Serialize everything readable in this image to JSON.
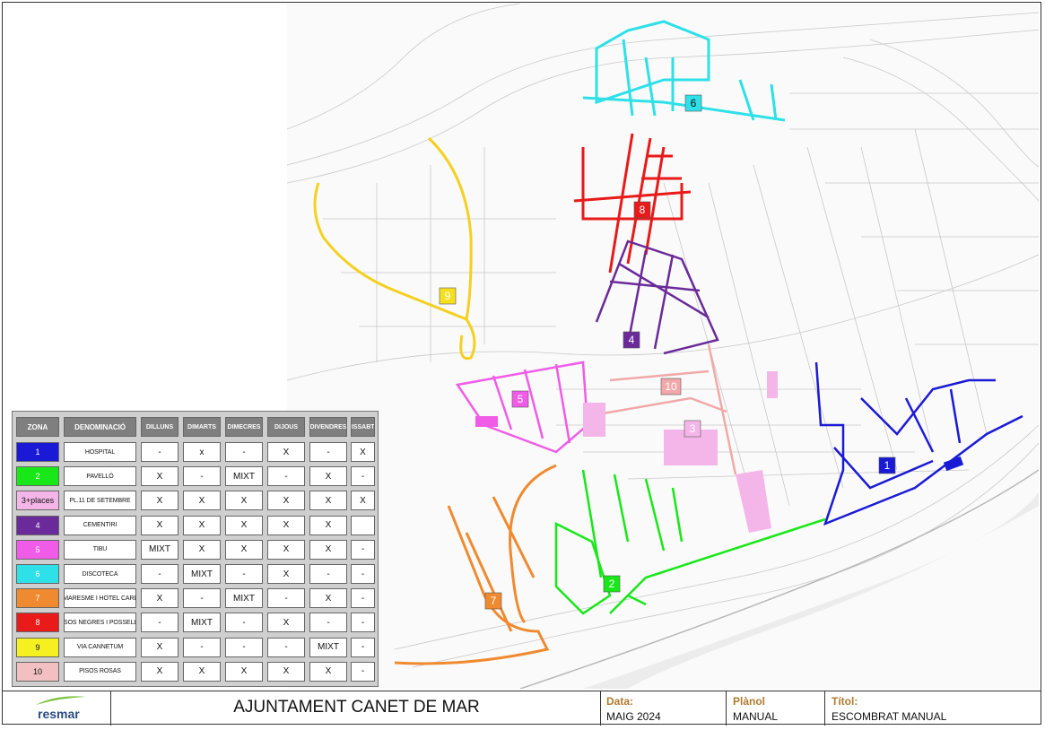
{
  "legend": {
    "headers": {
      "zona": "ZONA",
      "denominacio": "DENOMINACIÓ",
      "days": [
        "DILLUNS",
        "DIMARTS",
        "DIMECRES",
        "DIJOUS",
        "DIVENDRES",
        "DISSABTE"
      ]
    },
    "rows": [
      {
        "zona": "1",
        "color": "#1a1ad6",
        "text_color": "#ffffff",
        "name": "HOSPITAL",
        "days": [
          "-",
          "x",
          "-",
          "X",
          "-",
          "X"
        ]
      },
      {
        "zona": "2",
        "color": "#18e818",
        "text_color": "#ffffff",
        "name": "PAVELLÓ",
        "days": [
          "X",
          "-",
          "MIXT",
          "-",
          "X",
          "-"
        ]
      },
      {
        "zona": "3+places",
        "color": "#f4b6e8",
        "text_color": "#111111",
        "name": "PL.11 DE SETEMBRE",
        "days": [
          "X",
          "X",
          "X",
          "X",
          "X",
          "X"
        ]
      },
      {
        "zona": "4",
        "color": "#6a2a9a",
        "text_color": "#ffffff",
        "name": "CEMENTIRI",
        "days": [
          "X",
          "X",
          "X",
          "X",
          "X",
          ""
        ]
      },
      {
        "zona": "5",
        "color": "#f05ce8",
        "text_color": "#ffffff",
        "name": "TIBU",
        "days": [
          "MIXT",
          "X",
          "X",
          "X",
          "X",
          "-"
        ]
      },
      {
        "zona": "6",
        "color": "#2ee0e8",
        "text_color": "#ffffff",
        "name": "DISCOTECA",
        "days": [
          "-",
          "MIXT",
          "-",
          "X",
          "-",
          "-"
        ]
      },
      {
        "zona": "7",
        "color": "#f08a30",
        "text_color": "#ffffff",
        "name": "AV MARESME I HOTEL CARLOS",
        "days": [
          "X",
          "-",
          "MIXT",
          "-",
          "X",
          "-"
        ]
      },
      {
        "zona": "8",
        "color": "#e81a1a",
        "text_color": "#ffffff",
        "name": "PISOS NEGRES I POSSELLÓ",
        "days": [
          "-",
          "MIXT",
          "-",
          "X",
          "-",
          "-"
        ]
      },
      {
        "zona": "9",
        "color": "#f5f020",
        "text_color": "#111111",
        "name": "VIA CANNETUM",
        "days": [
          "X",
          "-",
          "-",
          "-",
          "MIXT",
          "-"
        ]
      },
      {
        "zona": "10",
        "color": "#f2c0c0",
        "text_color": "#111111",
        "name": "PISOS ROSAS",
        "days": [
          "X",
          "X",
          "X",
          "X",
          "X",
          "-"
        ]
      }
    ]
  },
  "map_zones": [
    {
      "label": "1",
      "color": "#1a1ad6",
      "text_color": "#ffffff"
    },
    {
      "label": "2",
      "color": "#18e818",
      "text_color": "#ffffff"
    },
    {
      "label": "3",
      "color": "#f4b6e8",
      "text_color": "#ffffff"
    },
    {
      "label": "4",
      "color": "#6a2a9a",
      "text_color": "#ffffff"
    },
    {
      "label": "5",
      "color": "#f05ce8",
      "text_color": "#ffffff"
    },
    {
      "label": "6",
      "color": "#2ee0e8",
      "text_color": "#111111"
    },
    {
      "label": "7",
      "color": "#f08a30",
      "text_color": "#ffffff"
    },
    {
      "label": "8",
      "color": "#e81a1a",
      "text_color": "#ffffff"
    },
    {
      "label": "9",
      "color": "#f5e020",
      "text_color": "#ffffff"
    },
    {
      "label": "10",
      "color": "#f2a8a8",
      "text_color": "#ffffff"
    }
  ],
  "title_block": {
    "logo": "resmar",
    "title": "AJUNTAMENT CANET DE MAR",
    "data_label": "Data:",
    "data_value": "MAIG 2024",
    "planol_label": "Plànol",
    "planol_value": "MANUAL",
    "titol_label": "Títol:",
    "titol_value": "ESCOMBRAT MANUAL"
  }
}
